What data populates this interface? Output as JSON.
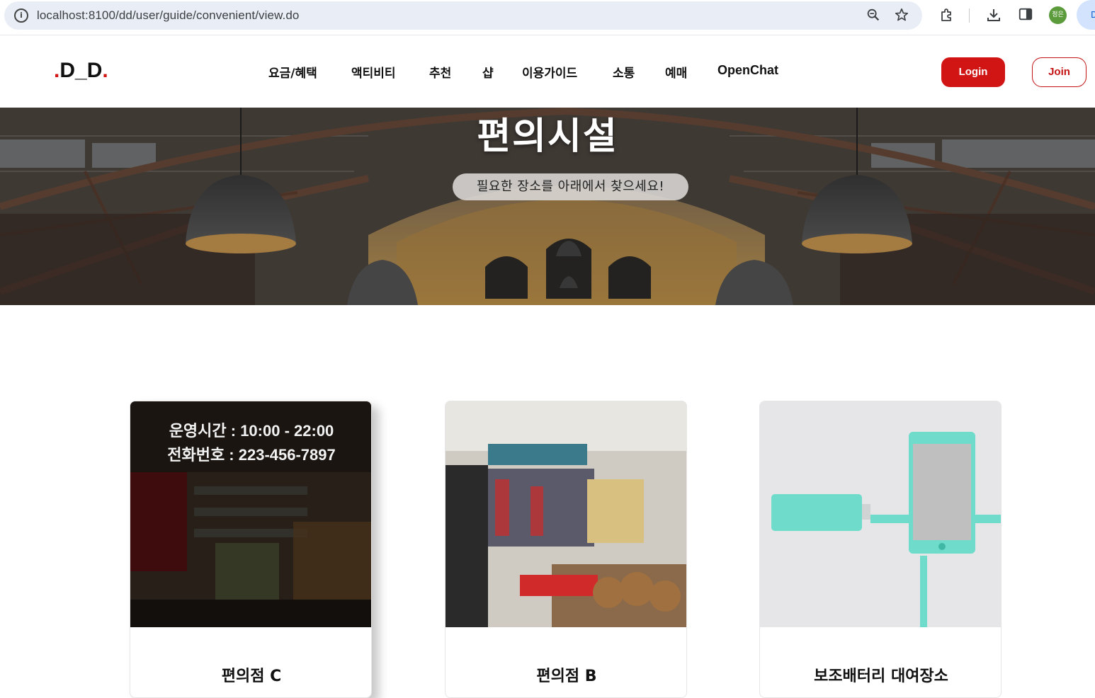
{
  "browser": {
    "url": "localhost:8100/dd/user/guide/convenient/view.do",
    "profile_initials": "정은",
    "profile_pill_text": "D"
  },
  "header": {
    "logo_dot_left": ".",
    "logo_text": "D_D",
    "logo_dot_right": ".",
    "nav": [
      "요금/혜택",
      "액티비티",
      "추천",
      "샵",
      "이용가이드",
      "소통",
      "예매",
      "OpenChat"
    ],
    "login_label": "Login",
    "join_label": "Join",
    "brand_color": "#d11414"
  },
  "hero": {
    "title": "편의시설",
    "subtitle": "필요한 장소를 아래에서 찾으세요!"
  },
  "cards": [
    {
      "title": "편의점 C",
      "overlay_hours": "운영시간 : 10:00 - 22:00",
      "overlay_phone": "전화번호 : 223-456-7897"
    },
    {
      "title": "편의점 B"
    },
    {
      "title": "보조배터리 대여장소"
    }
  ]
}
